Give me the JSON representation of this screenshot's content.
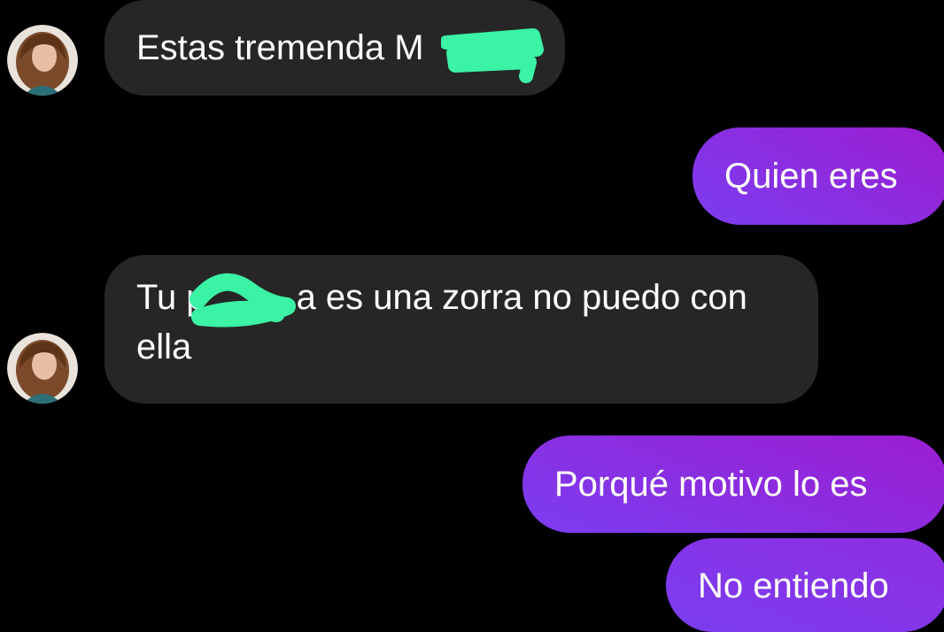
{
  "colors": {
    "background": "#000000",
    "incoming_bubble": "#262626",
    "outgoing_gradient_start": "#7b3df0",
    "outgoing_gradient_end": "#9c1dd0",
    "text": "#ffffff",
    "redaction": "#3af3a4"
  },
  "conversation": {
    "messages": [
      {
        "sender": "contact",
        "avatar_icon": "profile-photo-icon",
        "text": "Estas tremenda M"
      },
      {
        "sender": "me",
        "text": "Quien eres"
      },
      {
        "sender": "contact",
        "avatar_icon": "profile-photo-icon",
        "line1": "Tu p",
        "line1_tail": "a es una zorra no puedo con",
        "line2": "ella"
      },
      {
        "sender": "me",
        "text": "Porqué motivo lo es"
      },
      {
        "sender": "me",
        "text": "No entiendo"
      }
    ]
  }
}
